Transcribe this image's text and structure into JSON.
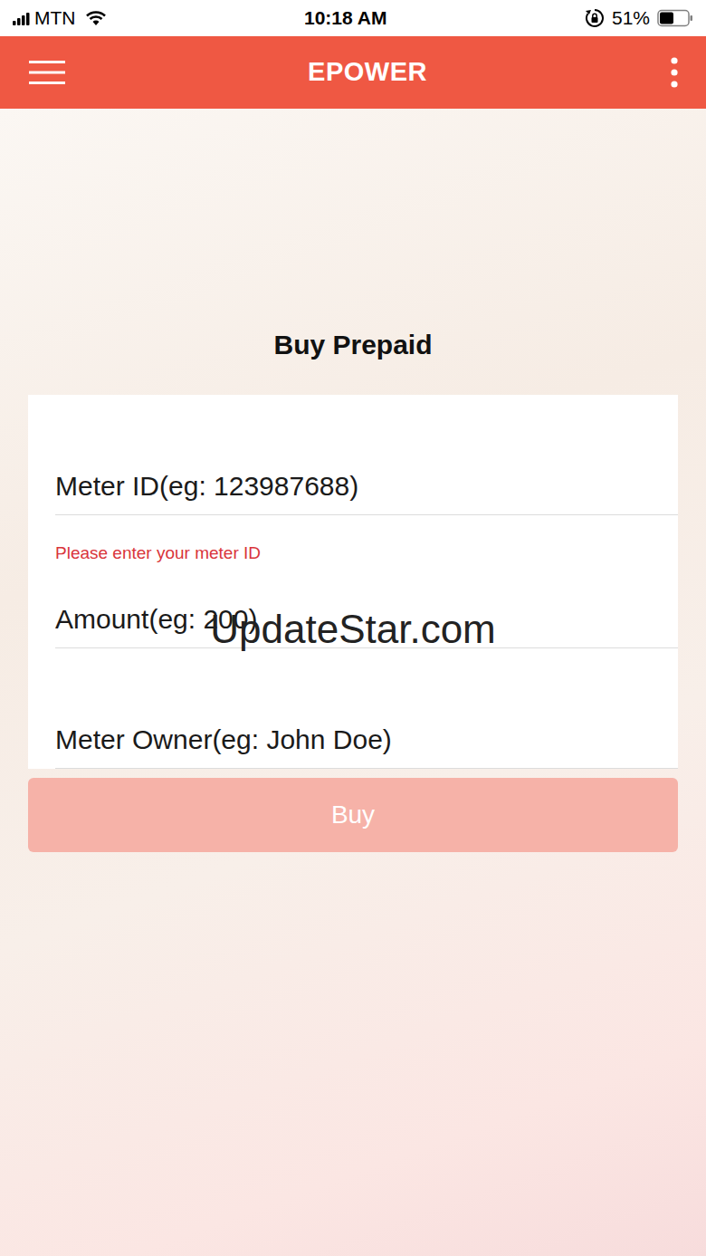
{
  "status_bar": {
    "carrier": "MTN",
    "signal_level": 1,
    "wifi": true,
    "time": "10:18 AM",
    "rotation_lock": true,
    "battery": "51%",
    "battery_level": 0.51
  },
  "app_bar": {
    "title": "EPOWER"
  },
  "form": {
    "title": "Buy Prepaid",
    "fields": [
      {
        "placeholder": "Meter ID(eg: 123987688)",
        "error": "Please enter your meter ID"
      },
      {
        "placeholder": "Amount(eg: 200)"
      },
      {
        "placeholder": "Meter Owner(eg: John Doe)"
      }
    ],
    "button": {
      "label": "Buy",
      "disabled": true
    }
  },
  "watermark": "UpdateStar.com"
}
